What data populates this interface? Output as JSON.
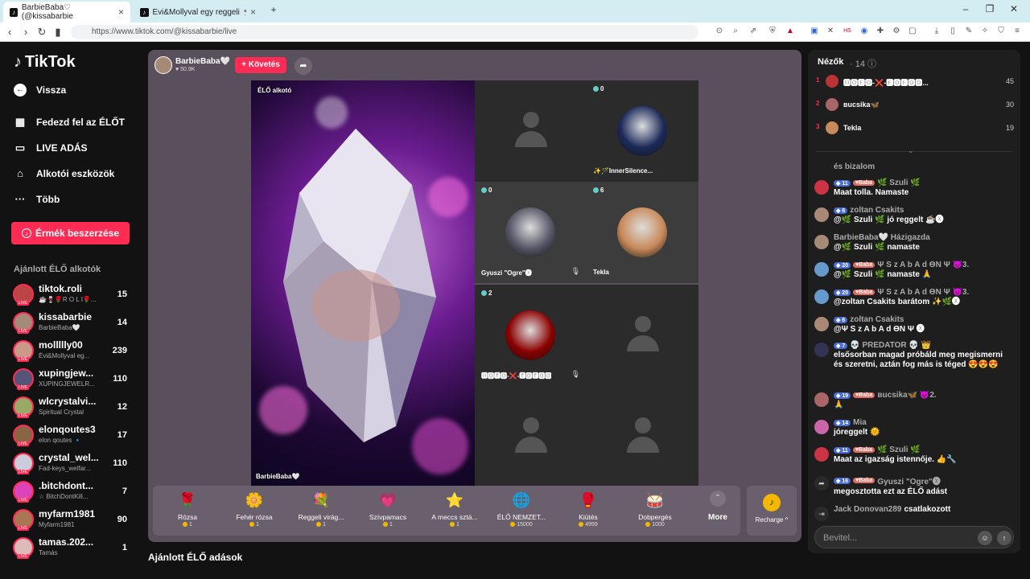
{
  "browser": {
    "tabs": [
      {
        "label": "BarbieBaba♡ (@kissabarbie"
      },
      {
        "label": "Évi&Mollyval egy reggeli ☕😍 (@m"
      }
    ],
    "new_tab": "+",
    "url": "https://www.tiktok.com/@kissabarbie/live",
    "ext_label": "HS"
  },
  "sidebar": {
    "logo": "TikTok",
    "back": "Vissza",
    "menu": [
      {
        "label": "Fedezd fel az ÉLŐT",
        "icon": "calendar-icon"
      },
      {
        "label": "LIVE ADÁS",
        "icon": "video-icon"
      },
      {
        "label": "Alkotói eszközök",
        "icon": "home-icon"
      },
      {
        "label": "Több",
        "icon": "dots-icon"
      }
    ],
    "coins_button": "Érmék beszerzése",
    "recommended_title": "Ajánlott ÉLŐ alkotók",
    "creators": [
      {
        "name": "tiktok.roli",
        "sub": "☕🍷🌹R O L I🌹...",
        "count": "15",
        "color": "#b44"
      },
      {
        "name": "kissabarbie",
        "sub": "BarbieBaba🤍",
        "count": "14",
        "color": "#a58a77"
      },
      {
        "name": "mollllly00",
        "sub": "Évi&Mollyval eg...",
        "count": "239",
        "color": "#c98"
      },
      {
        "name": "xupingjew...",
        "sub": "XUPINGJEWELR...",
        "count": "110",
        "color": "#557"
      },
      {
        "name": "wlcrystalvi...",
        "sub": "Spiritual Crystal",
        "count": "12",
        "color": "#9a6"
      },
      {
        "name": "elonqoutes3",
        "sub": "elon qoutes 🔹",
        "count": "17",
        "color": "#864"
      },
      {
        "name": "crystal_wel...",
        "sub": "Fad-keys_welfar...",
        "count": "110",
        "color": "#ccd"
      },
      {
        "name": ".bitchdont...",
        "sub": "☆ BitchDontKill...",
        "count": "7",
        "color": "#d4b"
      },
      {
        "name": "myfarm1981",
        "sub": "Myfarm1981",
        "count": "90",
        "color": "#a75"
      },
      {
        "name": "tamas.202...",
        "sub": "Tamás",
        "count": "1",
        "color": "#dbb"
      }
    ],
    "live_tag": "LIVE"
  },
  "stage": {
    "host_name": "BarbieBaba🤍",
    "host_likes": "♥ 50.9K",
    "follow": "+ Követés",
    "main_label": "ÉLŐ alkotó",
    "main_name": "BarbieBaba🤍",
    "guests": [
      {
        "badge": "",
        "name": "",
        "avatar": false
      },
      {
        "badge": "0",
        "name": "✨🪄InnerSilence...",
        "avatar": true,
        "color": "#1c2a5a"
      },
      {
        "badge": "0",
        "name": "Gyuszi \"Ogre\"🅧⃝",
        "avatar": true,
        "color": "#556"
      },
      {
        "badge": "6",
        "name": "Tekla",
        "avatar": true,
        "color": "#c88a5a"
      },
      {
        "badge": "2",
        "name": "🅼🅾🅵🅾-❌-🅵🅾🅵🅾🅾",
        "avatar": true,
        "color": "#8b0000"
      },
      {
        "badge": "",
        "name": "",
        "avatar": false
      },
      {
        "badge": "",
        "name": "",
        "avatar": false
      },
      {
        "badge": "",
        "name": "",
        "avatar": false
      }
    ],
    "gifts": [
      {
        "name": "Rózsa",
        "price": "1",
        "icon": "🌹"
      },
      {
        "name": "Fehér rózsa",
        "price": "1",
        "icon": "🌼"
      },
      {
        "name": "Reggeli virág...",
        "price": "1",
        "icon": "💐"
      },
      {
        "name": "Szívpamacs",
        "price": "1",
        "icon": "💗"
      },
      {
        "name": "A meccs sztá...",
        "price": "1",
        "icon": "⭐"
      },
      {
        "name": "ÉLŐ NEMZET...",
        "price": "15000",
        "icon": "🌐"
      },
      {
        "name": "Kiütés",
        "price": "4999",
        "icon": "🥊"
      },
      {
        "name": "Dobpergés",
        "price": "1000",
        "icon": "🥁"
      }
    ],
    "more": "More",
    "recharge": "Recharge ^",
    "recommended_lives": "Ajánlott ÉLŐ adások"
  },
  "panel": {
    "viewers_title": "Nézők",
    "viewers_count": "· 14 ⓘ",
    "viewers": [
      {
        "rank": "1",
        "name": "🅼🅾🅵🅾-❌-🅵🅾🅵🅾🅾...",
        "score": "45",
        "color": "#b33"
      },
      {
        "rank": "2",
        "name": "вucsika🦋",
        "score": "30",
        "color": "#a66"
      },
      {
        "rank": "3",
        "name": "Tekla",
        "score": "19",
        "color": "#c88a5a"
      }
    ],
    "chats": [
      {
        "level": "",
        "fan": "",
        "user": "",
        "msg": "és bizalom",
        "color": ""
      },
      {
        "level": "11",
        "fan": "Baba",
        "user": "🌿 Szuli 🌿",
        "msg": "Maat tolla. Namaste",
        "color": "#c34"
      },
      {
        "level": "6",
        "fan": "",
        "user": "zoltan Csakits",
        "msg": "@🌿 Szuli 🌿 jó reggelt ☕🅧",
        "color": "#a87"
      },
      {
        "level": "",
        "fan": "",
        "user": "BarbieBaba🤍 Házigazda",
        "msg": "@🌿 Szuli 🌿 namaste",
        "color": "#a58a77"
      },
      {
        "level": "20",
        "fan": "Baba",
        "user": "Ψ S z A b A d ƟN Ψ 😈3.",
        "msg": "@🌿 Szuli 🌿 namaste 🙏",
        "color": "#69c"
      },
      {
        "level": "20",
        "fan": "Baba",
        "user": "Ψ S z A b A d ƟN Ψ 😈3.",
        "msg": "@zoltan Csakits barátom ✨🌿🅧",
        "color": "#69c"
      },
      {
        "level": "6",
        "fan": "",
        "user": "zoltan Csakits",
        "msg": "@Ψ S z A b A d ƟN Ψ 🅧",
        "color": "#a87"
      },
      {
        "level": "7",
        "fan": "",
        "user": "💀 PREDATOR 💀 👑",
        "msg": "elsősorban magad próbáld meg megismerni és szeretni, aztán fog más is téged 😍😍😍",
        "color": "#335"
      },
      {
        "level": "19",
        "fan": "Baba",
        "user": "вucsika🦋 😈2.",
        "msg": "🙏",
        "color": "#a66"
      },
      {
        "level": "14",
        "fan": "",
        "user": "Mia",
        "msg": "jóreggelt 🌞",
        "color": "#c6a"
      },
      {
        "level": "11",
        "fan": "Baba",
        "user": "🌿 Szuli 🌿",
        "msg": "Maat az igazság istennője. 👍🔧",
        "color": "#c34"
      },
      {
        "level": "16",
        "fan": "Baba",
        "user": "Gyuszi \"Ogre\"🅧",
        "msg": "megosztotta ezt az ÉLŐ adást",
        "color": "#444"
      },
      {
        "level": "",
        "fan": "",
        "user": "Jack Donovan289",
        "msg": "csatlakozott",
        "color": "#444"
      }
    ],
    "input_placeholder": "Bevitel..."
  }
}
